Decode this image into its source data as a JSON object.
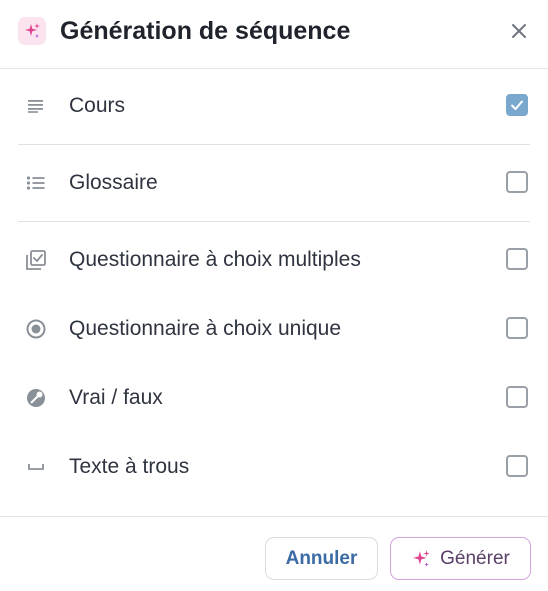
{
  "dialog": {
    "title": "Génération de séquence",
    "header_icon": "sparkles-icon",
    "close_icon": "close-icon"
  },
  "options": [
    {
      "icon": "lines-icon",
      "label": "Cours",
      "checked": true
    },
    {
      "icon": "bullet-list-icon",
      "label": "Glossaire",
      "checked": false
    },
    {
      "icon": "stacked-checkbox-icon",
      "label": "Questionnaire à choix multiples",
      "checked": false
    },
    {
      "icon": "radio-button-icon",
      "label": "Questionnaire à choix unique",
      "checked": false
    },
    {
      "icon": "half-circle-icon",
      "label": "Vrai / faux",
      "checked": false
    },
    {
      "icon": "blank-space-icon",
      "label": "Texte à trous",
      "checked": false
    }
  ],
  "footer": {
    "cancel_label": "Annuler",
    "generate_label": "Générer"
  },
  "colors": {
    "accent_check": "#79a7cd",
    "cancel_text": "#3b6aa4",
    "generate_border": "#d4a2df",
    "sparkle_pink": "#e0448f"
  }
}
